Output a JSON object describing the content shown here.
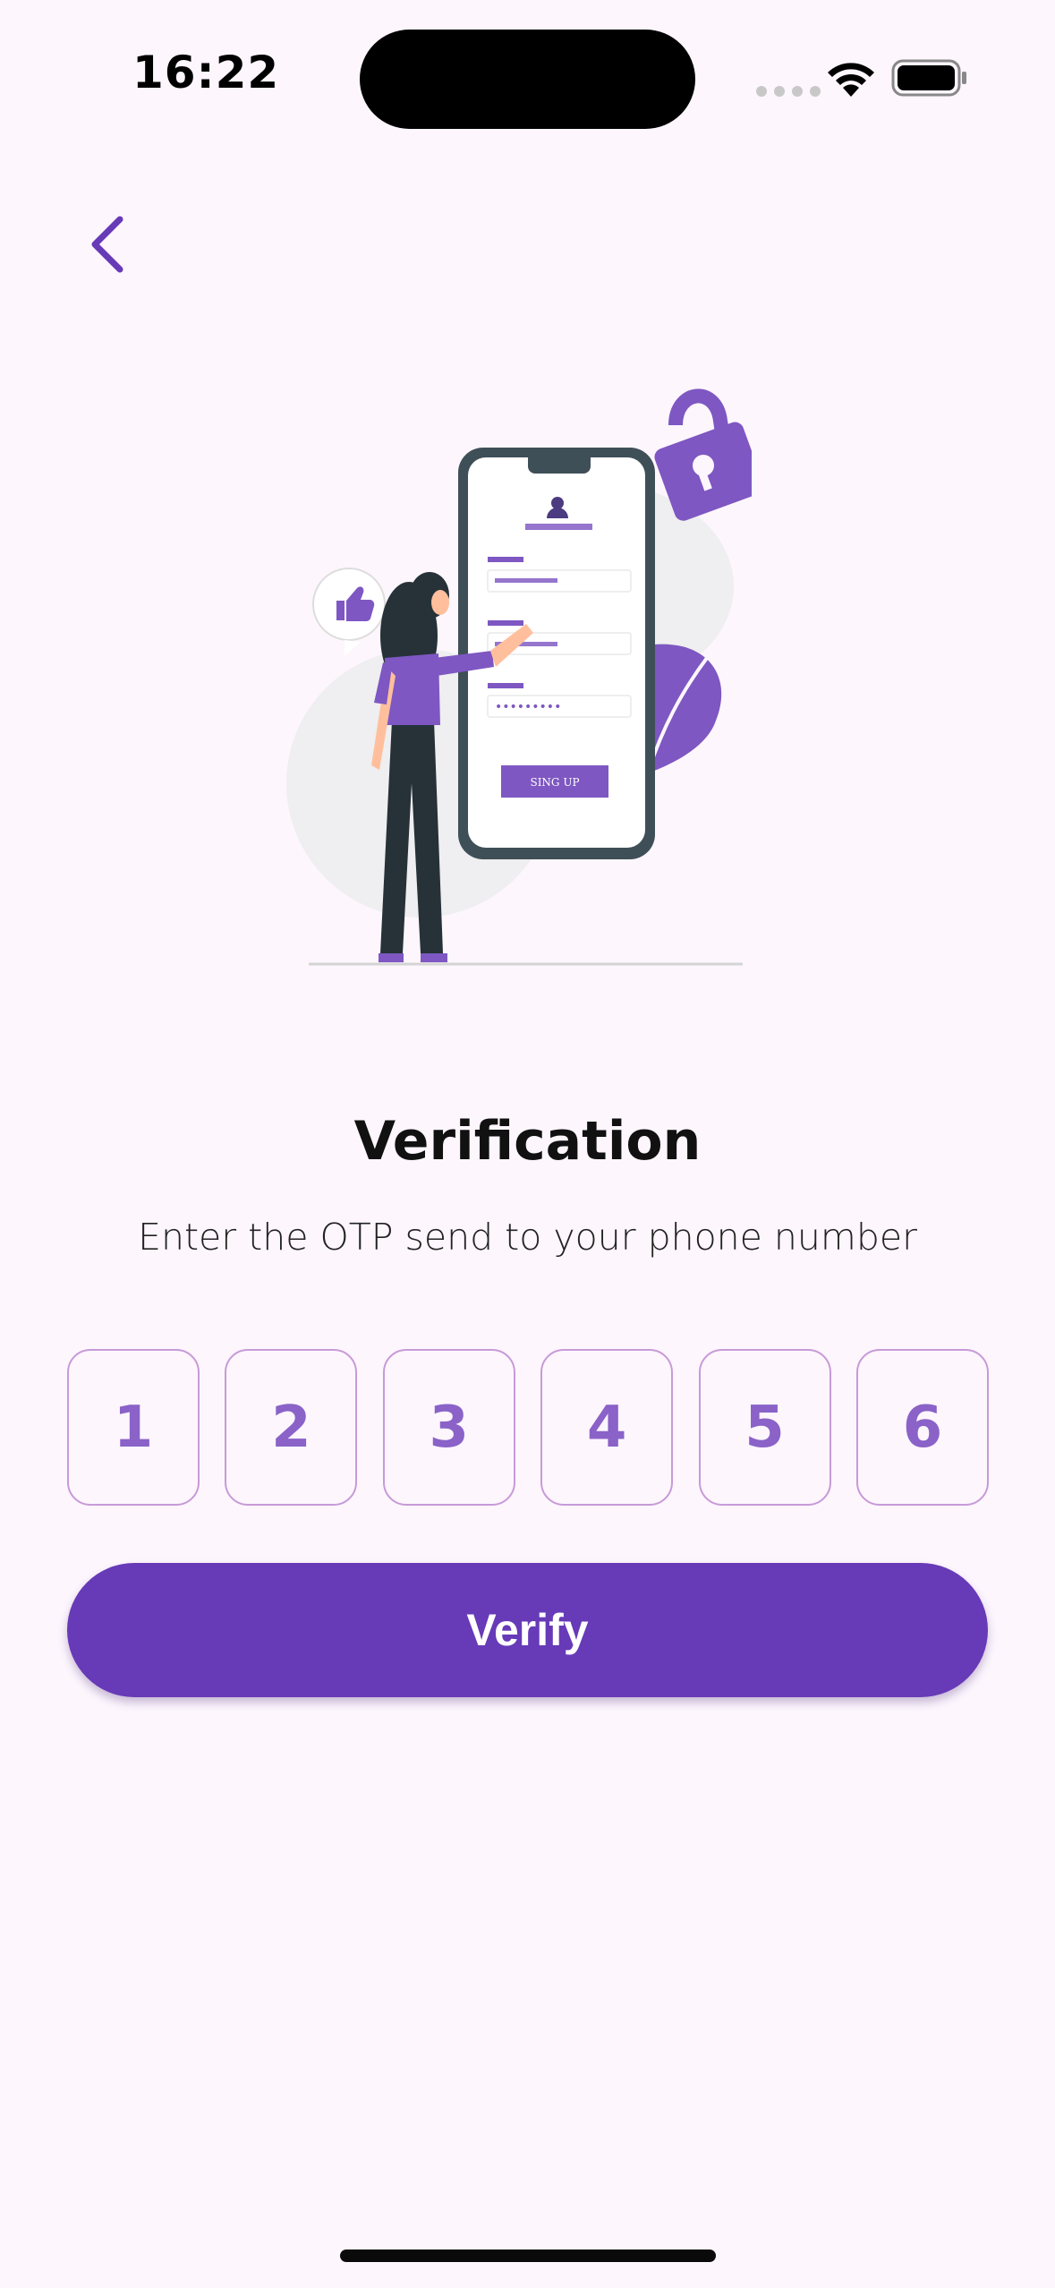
{
  "status_bar": {
    "time": "16:22"
  },
  "header": {
    "back_icon": "chevron-left-icon"
  },
  "illustration": {
    "signup_button_label": "SING UP",
    "password_mask": "•••••••••",
    "icons": [
      "user-icon",
      "lock-icon",
      "thumbs-up-icon",
      "leaf-icon"
    ]
  },
  "content": {
    "title": "Verification",
    "subtitle": "Enter the OTP send to your phone number"
  },
  "otp": {
    "digits": [
      "1",
      "2",
      "3",
      "4",
      "5",
      "6"
    ]
  },
  "actions": {
    "verify_label": "Verify"
  },
  "colors": {
    "background": "#fdf6fd",
    "accent": "#673ab7",
    "otp_border": "#c79ad7",
    "otp_text": "#8a62c8"
  }
}
